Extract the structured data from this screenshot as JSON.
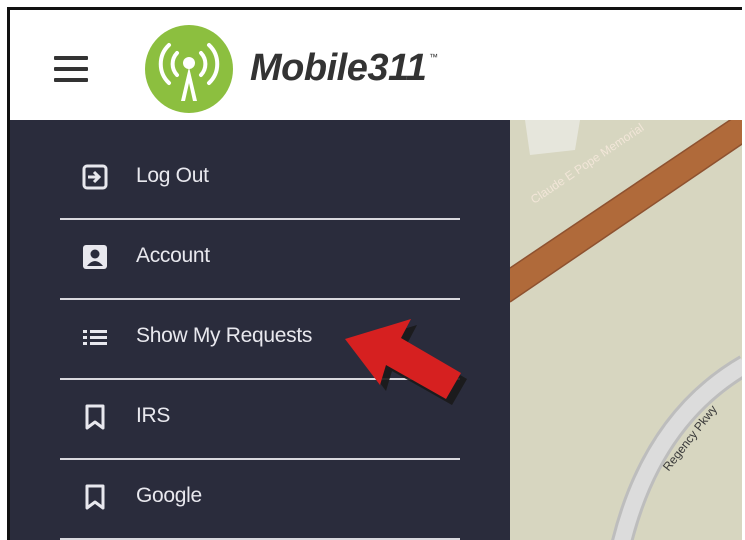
{
  "header": {
    "app_name": "Mobile311",
    "trademark": "™",
    "menu_icon": "hamburger-menu-icon",
    "logo_icon": "antenna-signal-icon"
  },
  "colors": {
    "drawer_bg": "#2a2c3c",
    "logo_green": "#8cbf3f",
    "arrow_red": "#d62020",
    "road_brown": "#b06a3a",
    "map_bg": "#d7d6c0"
  },
  "menu": {
    "items": [
      {
        "label": "Log Out",
        "icon": "logout-icon"
      },
      {
        "label": "Account",
        "icon": "account-icon"
      },
      {
        "label": "Show My Requests",
        "icon": "list-icon"
      },
      {
        "label": "IRS",
        "icon": "bookmark-icon"
      },
      {
        "label": "Google",
        "icon": "bookmark-icon"
      }
    ]
  },
  "map": {
    "road_label_1": "Claude E Pope Memorial",
    "road_label_2": "Regency Pkwy"
  }
}
